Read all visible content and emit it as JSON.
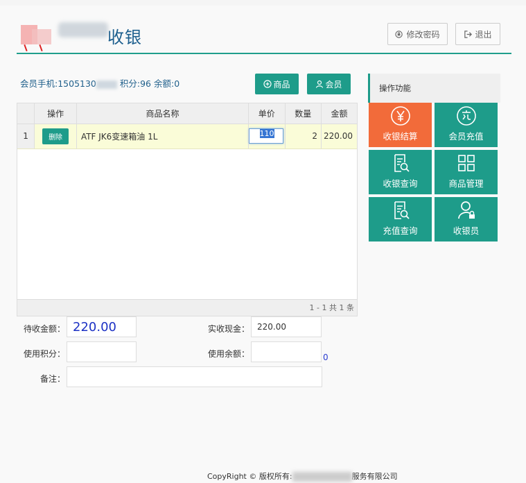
{
  "header": {
    "title": "收银",
    "change_password": "修改密码",
    "logout": "退出"
  },
  "member": {
    "phone_label": "会员手机:",
    "phone_value": "1505130",
    "points_text": "积分:96",
    "balance_text": "余额:0"
  },
  "toolbar": {
    "product_button": "商品",
    "member_button": "会员"
  },
  "table": {
    "columns": [
      "操作",
      "商品名称",
      "单价",
      "数量",
      "金额"
    ],
    "rows": [
      {
        "index": "1",
        "action": "删除",
        "name": "ATF JK6变速箱油 1L",
        "price": "110",
        "qty": "2",
        "amount": "220.00"
      }
    ],
    "pager": "1 - 1   共 1 条"
  },
  "form": {
    "due_label": "待收金额：",
    "due_value": "220.00",
    "cash_label": "实收现金：",
    "cash_value": "220.00",
    "points_label": "使用积分：",
    "points_value": "",
    "balance_label": "使用余额：",
    "balance_value": "",
    "balance_available": "0",
    "remark_label": "备注：",
    "remark_value": ""
  },
  "side": {
    "title": "操作功能",
    "tiles": [
      {
        "label": "收银结算",
        "icon": "yen-icon",
        "color": "#f26b3a"
      },
      {
        "label": "会员充值",
        "icon": "recharge-icon",
        "color": "#1e9c8a"
      },
      {
        "label": "收银查询",
        "icon": "document-search-icon",
        "color": "#1e9c8a"
      },
      {
        "label": "商品管理",
        "icon": "grid-icon",
        "color": "#1e9c8a"
      },
      {
        "label": "充值查询",
        "icon": "document-search-icon",
        "color": "#1e9c8a"
      },
      {
        "label": "收银员",
        "icon": "user-lock-icon",
        "color": "#1e9c8a"
      }
    ]
  },
  "footer": {
    "prefix": "CopyRight © 版权所有:",
    "suffix": "服务有限公司"
  }
}
